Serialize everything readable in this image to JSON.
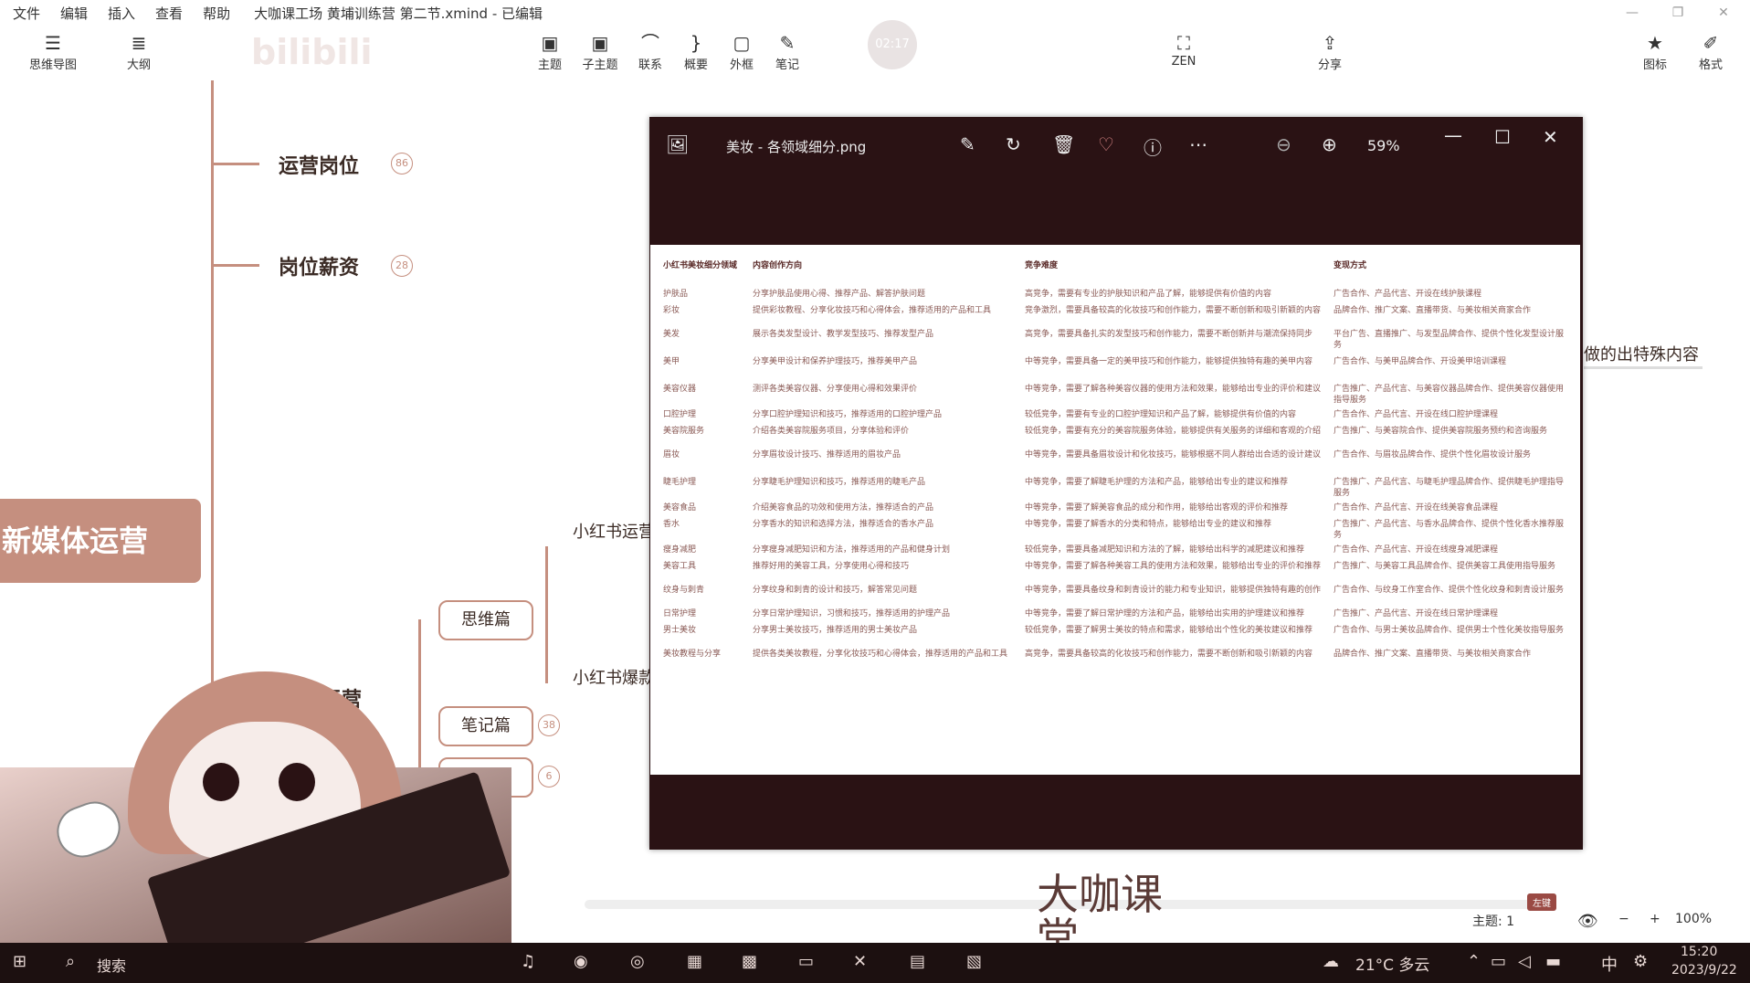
{
  "menubar": {
    "items": [
      "文件",
      "编辑",
      "插入",
      "查看",
      "帮助"
    ],
    "title": "大咖课工场 黄埔训练营 第二节.xmind - 已编辑"
  },
  "toolbar": {
    "left": [
      {
        "label": "思维导图",
        "icon": "mindmap-icon"
      },
      {
        "label": "大纲",
        "icon": "outline-icon"
      }
    ],
    "center": [
      {
        "label": "主题",
        "icon": "topic-icon"
      },
      {
        "label": "子主题",
        "icon": "subtopic-icon"
      },
      {
        "label": "联系",
        "icon": "relationship-icon"
      },
      {
        "label": "概要",
        "icon": "summary-icon"
      },
      {
        "label": "外框",
        "icon": "boundary-icon"
      },
      {
        "label": "笔记",
        "icon": "note-icon"
      }
    ],
    "zen": "ZEN",
    "share": "分享",
    "right": [
      {
        "label": "图标",
        "icon": "star-icon"
      },
      {
        "label": "格式",
        "icon": "format-icon"
      }
    ],
    "timer": "02:17",
    "watermark": "bilibili"
  },
  "mindmap": {
    "branches": [
      {
        "label": "运营岗位",
        "count": "86"
      },
      {
        "label": "岗位薪资",
        "count": "28"
      }
    ],
    "central": "新媒体运营",
    "partial_label": "书运营",
    "children": [
      {
        "label": "思维篇"
      },
      {
        "label": "笔记篇",
        "count": "38"
      },
      {
        "label": "工具篇",
        "count": "6"
      }
    ],
    "leaves": [
      "小红书运营",
      "小红书爆款"
    ],
    "behind_viewer": "做的出特殊内容"
  },
  "viewer": {
    "filename": "美妆 - 各领域细分.png",
    "zoom": "59%",
    "table": {
      "headers": [
        "小红书美妆细分领域",
        "内容创作方向",
        "竞争难度",
        "变现方式"
      ],
      "rows": [
        [
          "护肤品",
          "分享护肤品使用心得、推荐产品、解答护肤问题",
          "高竞争，需要有专业的护肤知识和产品了解，能够提供有价值的内容",
          "广告合作、产品代言、开设在线护肤课程"
        ],
        [
          "彩妆",
          "提供彩妆教程、分享化妆技巧和心得体会，推荐适用的产品和工具",
          "竞争激烈，需要具备较高的化妆技巧和创作能力，需要不断创新和吸引新颖的内容",
          "品牌合作、推广文案、直播带货、与美妆相关商家合作"
        ],
        [
          "美发",
          "展示各类发型设计、教学发型技巧、推荐发型产品",
          "高竞争，需要具备扎实的发型技巧和创作能力，需要不断创新并与潮流保持同步",
          "平台广告、直播推广、与发型品牌合作、提供个性化发型设计服务"
        ],
        [
          "美甲",
          "分享美甲设计和保养护理技巧，推荐美甲产品",
          "中等竞争，需要具备一定的美甲技巧和创作能力，能够提供独特有趣的美甲内容",
          "广告合作、与美甲品牌合作、开设美甲培训课程"
        ],
        [
          "美容仪器",
          "测评各类美容仪器、分享使用心得和效果评价",
          "中等竞争，需要了解各种美容仪器的使用方法和效果，能够给出专业的评价和建议",
          "广告推广、产品代言、与美容仪器品牌合作、提供美容仪器使用指导服务"
        ],
        [
          "口腔护理",
          "分享口腔护理知识和技巧，推荐适用的口腔护理产品",
          "较低竞争，需要有专业的口腔护理知识和产品了解，能够提供有价值的内容",
          "广告合作、产品代言、开设在线口腔护理课程"
        ],
        [
          "美容院服务",
          "介绍各类美容院服务项目，分享体验和评价",
          "较低竞争，需要有充分的美容院服务体验，能够提供有关服务的详细和客观的介绍",
          "广告推广、与美容院合作、提供美容院服务预约和咨询服务"
        ],
        [
          "眉妆",
          "分享眉妆设计技巧、推荐适用的眉妆产品",
          "中等竞争，需要具备眉妆设计和化妆技巧，能够根据不同人群给出合适的设计建议",
          "广告合作、与眉妆品牌合作、提供个性化眉妆设计服务"
        ],
        [
          "睫毛护理",
          "分享睫毛护理知识和技巧，推荐适用的睫毛产品",
          "中等竞争，需要了解睫毛护理的方法和产品，能够给出专业的建议和推荐",
          "广告推广、产品代言、与睫毛护理品牌合作、提供睫毛护理指导服务"
        ],
        [
          "美容食品",
          "介绍美容食品的功效和使用方法，推荐适合的产品",
          "中等竞争，需要了解美容食品的成分和作用，能够给出客观的评价和推荐",
          "广告合作、产品代言、开设在线美容食品课程"
        ],
        [
          "香水",
          "分享香水的知识和选择方法，推荐适合的香水产品",
          "中等竞争，需要了解香水的分类和特点，能够给出专业的建议和推荐",
          "广告推广、产品代言、与香水品牌合作、提供个性化香水推荐服务"
        ],
        [
          "瘦身减肥",
          "分享瘦身减肥知识和方法，推荐适用的产品和健身计划",
          "较低竞争，需要具备减肥知识和方法的了解，能够给出科学的减肥建议和推荐",
          "广告合作、产品代言、开设在线瘦身减肥课程"
        ],
        [
          "美容工具",
          "推荐好用的美容工具，分享使用心得和技巧",
          "中等竞争，需要了解各种美容工具的使用方法和效果，能够给出专业的评价和推荐",
          "广告推广、与美容工具品牌合作、提供美容工具使用指导服务"
        ],
        [
          "纹身与刺青",
          "分享纹身和刺青的设计和技巧，解答常见问题",
          "中等竞争，需要具备纹身和刺青设计的能力和专业知识，能够提供独特有趣的创作",
          "广告合作、与纹身工作室合作、提供个性化纹身和刺青设计服务"
        ],
        [
          "日常护理",
          "分享日常护理知识，习惯和技巧，推荐适用的护理产品",
          "中等竞争，需要了解日常护理的方法和产品，能够给出实用的护理建议和推荐",
          "广告推广、产品代言、开设在线日常护理课程"
        ],
        [
          "男士美妆",
          "分享男士美妆技巧，推荐适用的男士美妆产品",
          "较低竞争，需要了解男士美妆的特点和需求，能够给出个性化的美妆建议和推荐",
          "广告合作、与男士美妆品牌合作、提供男士个性化美妆指导服务"
        ],
        [
          "美妆教程与分享",
          "提供各类美妆教程，分享化妆技巧和心得体会，推荐适用的产品和工具",
          "高竞争，需要具备较高的化妆技巧和创作能力，需要不断创新和吸引新颖的内容",
          "品牌合作、推广文案、直播带货、与美妆相关商家合作"
        ]
      ]
    }
  },
  "status": {
    "topic_label": "主题: 1",
    "zoom": "100%",
    "tag": "左键"
  },
  "logo_text": "大咖课堂",
  "taskbar": {
    "search": "搜索",
    "weather": "21°C 多云",
    "ime": "中",
    "time": "15:20",
    "date": "2023/9/22"
  }
}
